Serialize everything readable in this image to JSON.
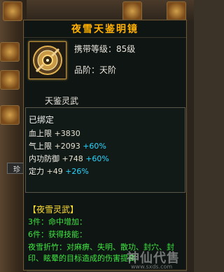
{
  "tooltip": {
    "title": "夜雪天鉴明镜",
    "carry_level": "携带等级：85级",
    "rank": "品阶：天阶",
    "item_name": "天鉴灵武",
    "bound": "已绑定",
    "stats": [
      {
        "name": "血上限",
        "value": "+3830",
        "bonus": ""
      },
      {
        "name": "气上限",
        "value": "+2093",
        "bonus": "+60%"
      },
      {
        "name": "内功防御",
        "value": "+748",
        "bonus": "+60%"
      },
      {
        "name": "定力",
        "value": "+49",
        "bonus": "+26%"
      }
    ],
    "set": {
      "title": "【夜雪灵武】",
      "piece3": "3件：命中增加：",
      "piece6": "6件：获得技能：",
      "skill_desc": "夜雪折竹：对麻痹、失明、散功、封穴、封印、眩晕的目标造成的伤害提高"
    }
  },
  "background": {
    "side_tab": "珍"
  },
  "watermark": {
    "text": "神仙代售",
    "url": "www.sxds.com"
  },
  "colors": {
    "title": "#ffb000",
    "bonus": "#28d6ff",
    "set_title": "#ffe033",
    "set_text": "#3ee641"
  }
}
